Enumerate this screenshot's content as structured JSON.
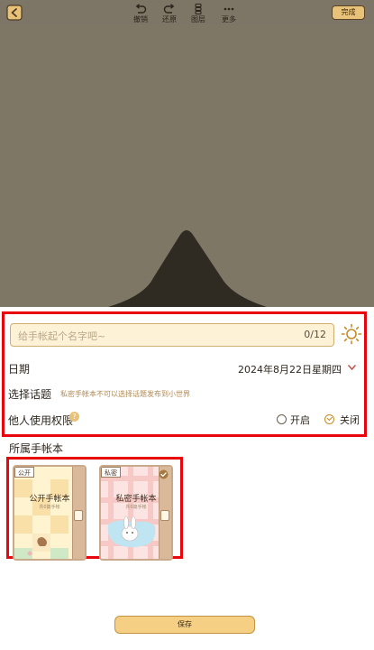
{
  "toolbar": {
    "back_icon": "back-arrow-icon",
    "undo_label": "撤销",
    "redo_label": "还原",
    "layers_label": "图层",
    "more_label": "更多",
    "done_label": "完成"
  },
  "form": {
    "name_placeholder": "给手帐起个名字吧~",
    "name_counter": "0/12",
    "theme_icon": "sun-icon",
    "date_label": "日期",
    "date_value": "2024年8月22日",
    "weekday_value": "星期四",
    "topic_label": "选择话题",
    "topic_hint": "私密手帐本不可以选择话题发布到小世界",
    "permission_label": "他人使用权限",
    "help_glyph": "?",
    "option_open": "开启",
    "option_close": "关闭",
    "selected_permission": "关闭"
  },
  "notebooks": {
    "section_title": "所属手帐本",
    "items": [
      {
        "tag": "公开",
        "title": "公开手帐本",
        "subtitle": "共0篇手帐",
        "selected": false
      },
      {
        "tag": "私密",
        "title": "私密手帐本",
        "subtitle": "共0篇手帐",
        "selected": true
      }
    ]
  },
  "footer": {
    "save_label": "保存"
  },
  "colors": {
    "accent": "#e9c27a",
    "highlight_frame": "#e8050c",
    "canvas_bg": "#7e7766"
  }
}
